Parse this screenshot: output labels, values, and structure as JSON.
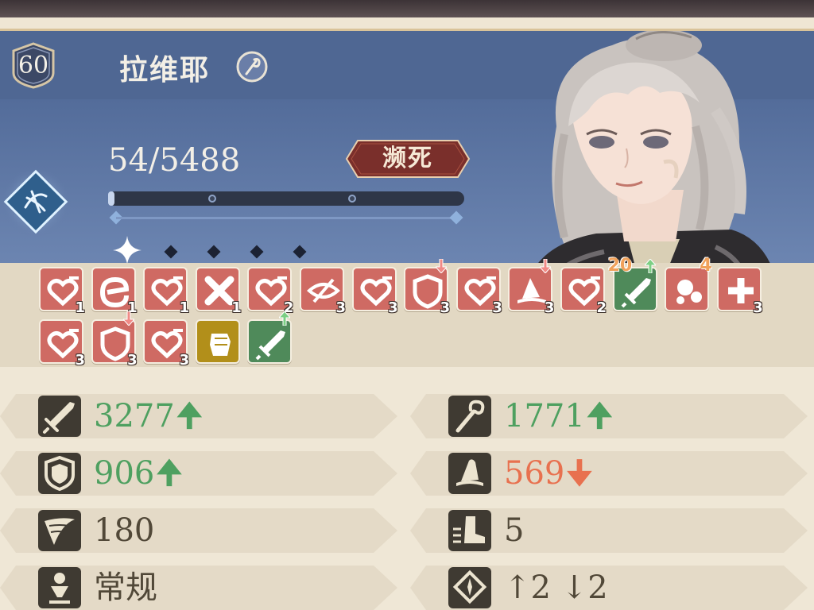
{
  "character": {
    "level": "60",
    "name": "拉维耶",
    "class_icon": "staff-class-icon",
    "element_icon": "wind-element-icon",
    "hp_text": "54/5488",
    "hp_fraction": 0.0098,
    "status_label": "濒死",
    "action_points": {
      "filled": 1,
      "empty": 4
    }
  },
  "buffs": [
    {
      "icon": "heart-down-icon",
      "color": "red",
      "count": "1"
    },
    {
      "icon": "energy-e-icon",
      "color": "red",
      "count": "1"
    },
    {
      "icon": "heart-down-icon",
      "color": "red",
      "count": "1"
    },
    {
      "icon": "cross-cancel-icon",
      "color": "red",
      "count": "1"
    },
    {
      "icon": "heart-down-icon",
      "color": "red",
      "count": "2"
    },
    {
      "icon": "eye-blind-icon",
      "color": "red",
      "count": "3"
    },
    {
      "icon": "heart-down-icon",
      "color": "red",
      "count": "3"
    },
    {
      "icon": "shield-down-icon",
      "color": "red",
      "count": "3",
      "arrow": "down"
    },
    {
      "icon": "heart-down-icon",
      "color": "red",
      "count": "3"
    },
    {
      "icon": "hat-down-icon",
      "color": "red",
      "count": "3",
      "arrow": "down"
    },
    {
      "icon": "heart-down-icon",
      "color": "red",
      "count": "2"
    },
    {
      "icon": "sword-up-icon",
      "color": "green",
      "count": "",
      "arrow": "up",
      "top_label": "20"
    },
    {
      "icon": "bubbles-icon",
      "color": "red",
      "count": "",
      "top_label": "4"
    },
    {
      "icon": "cross-plus-icon",
      "color": "red",
      "count": "3"
    },
    {
      "icon": "heart-down-icon",
      "color": "red",
      "count": "3"
    },
    {
      "icon": "shield-down-icon",
      "color": "red",
      "count": "3",
      "arrow": "down"
    },
    {
      "icon": "heart-down-icon",
      "color": "red",
      "count": "3"
    },
    {
      "icon": "fist-icon",
      "color": "gold",
      "count": ""
    },
    {
      "icon": "sword-up-icon",
      "color": "green",
      "count": "",
      "arrow": "up"
    }
  ],
  "stats": {
    "attack": {
      "icon": "sword-icon",
      "value": "3277",
      "trend": "up"
    },
    "magic_attack": {
      "icon": "staff-icon",
      "value": "1771",
      "trend": "up"
    },
    "defense": {
      "icon": "shield-icon",
      "value": "906",
      "trend": "up"
    },
    "magic_defense": {
      "icon": "wizard-hat-icon",
      "value": "569",
      "trend": "down"
    },
    "speed": {
      "icon": "wing-icon",
      "value": "180",
      "trend": "none"
    },
    "movement": {
      "icon": "boot-icon",
      "value": "5",
      "trend": "none"
    },
    "type": {
      "icon": "person-type-icon",
      "value": "常规",
      "trend": "none"
    },
    "elevation": {
      "icon": "jump-icon",
      "value": "↑2 ↓2",
      "trend": "none"
    }
  },
  "colors": {
    "up": "#4ea060",
    "down": "#e8714f",
    "debuff_tile": "#cf6a63",
    "buff_tile": "#4f8a5a",
    "panel": "#5d76a3"
  }
}
